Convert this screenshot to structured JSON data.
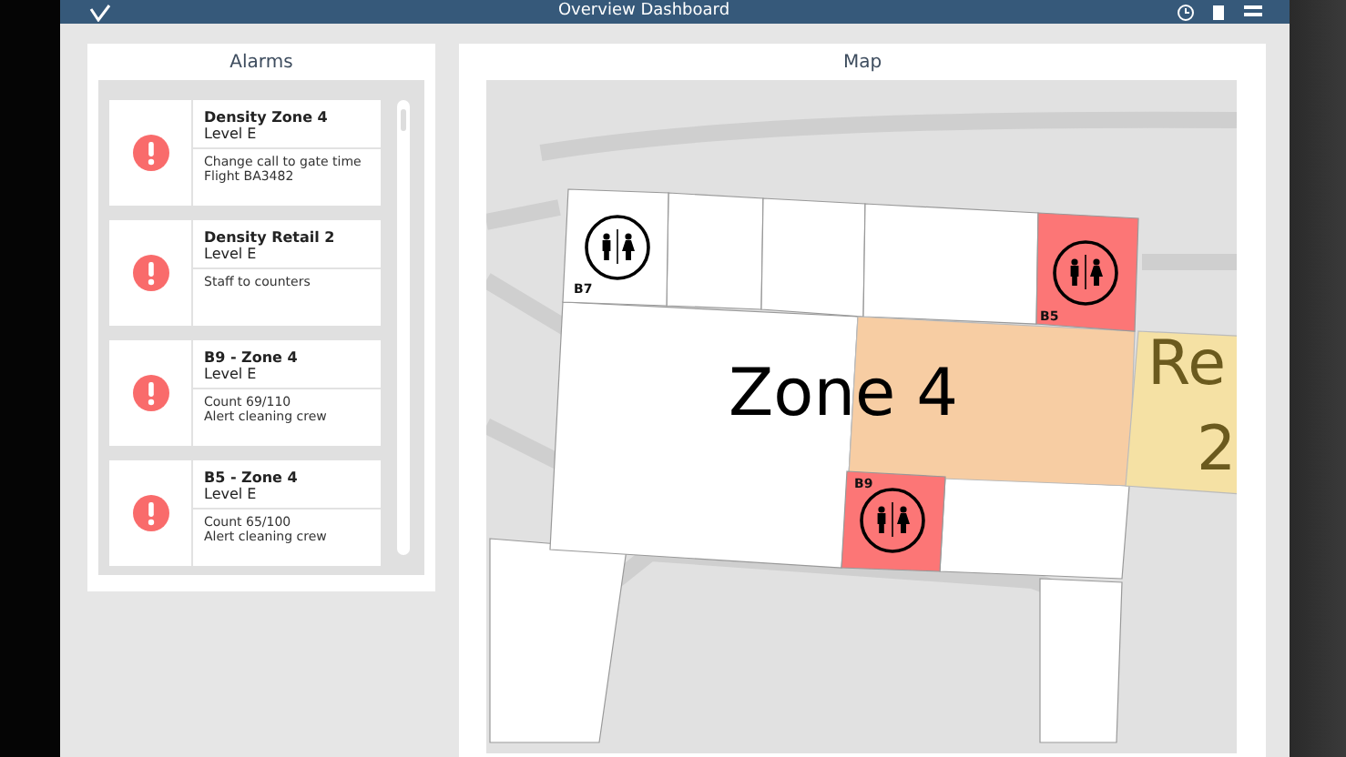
{
  "header": {
    "title": "Overview Dashboard"
  },
  "alarms": {
    "title": "Alarms",
    "items": [
      {
        "title": "Density Zone 4",
        "level": "Level E",
        "lines": [
          "Change call to gate time",
          "Flight BA3482"
        ]
      },
      {
        "title": "Density Retail 2",
        "level": "Level E",
        "lines": [
          "Staff to counters"
        ]
      },
      {
        "title": "B9 - Zone 4",
        "level": "Level E",
        "lines": [
          "Count 69/110",
          "Alert cleaning crew"
        ]
      },
      {
        "title": "B5 - Zone 4",
        "level": "Level E",
        "lines": [
          "Count 65/100",
          "Alert cleaning crew"
        ]
      }
    ]
  },
  "map": {
    "title": "Map",
    "areas": [
      {
        "label": [
          "Zone 4"
        ],
        "color": "#f7cda3"
      },
      {
        "label": [
          "Re",
          "2"
        ],
        "color": "#f5e1a4"
      }
    ],
    "restrooms": [
      {
        "label": "B7",
        "color": "#ffffff"
      },
      {
        "label": "B5",
        "color": "#fc7676"
      },
      {
        "label": "B9",
        "color": "#fc7676"
      }
    ]
  }
}
